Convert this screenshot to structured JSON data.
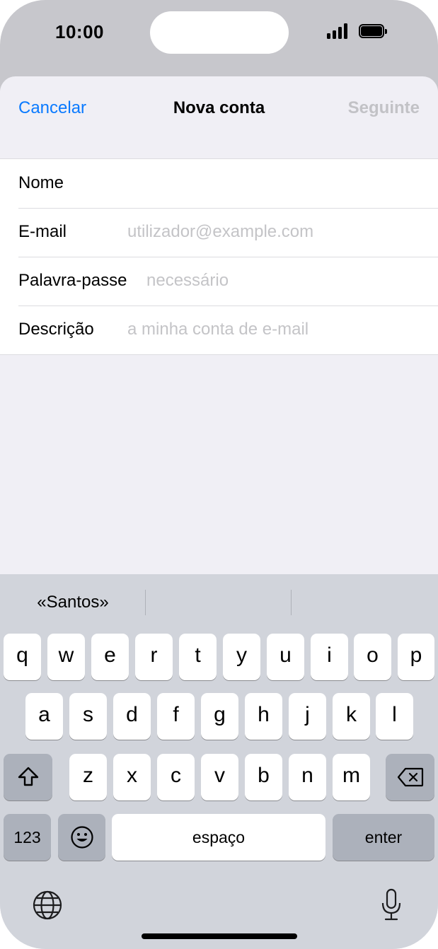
{
  "status_bar": {
    "time": "10:00"
  },
  "nav": {
    "cancel_label": "Cancelar",
    "title": "Nova conta",
    "next_label": "Seguinte"
  },
  "form": {
    "fields": [
      {
        "label": "Nome",
        "value": "",
        "placeholder": ""
      },
      {
        "label": "E-mail",
        "value": "",
        "placeholder": "utilizador@example.com"
      },
      {
        "label": "Palavra-passe",
        "value": "",
        "placeholder": "necessário"
      },
      {
        "label": "Descrição",
        "value": "",
        "placeholder": "a minha conta de e-mail"
      }
    ]
  },
  "keyboard": {
    "suggestions": [
      "«Santos»",
      "",
      ""
    ],
    "row1": [
      "q",
      "w",
      "e",
      "r",
      "t",
      "y",
      "u",
      "i",
      "o",
      "p"
    ],
    "row2": [
      "a",
      "s",
      "d",
      "f",
      "g",
      "h",
      "j",
      "k",
      "l"
    ],
    "row3": [
      "z",
      "x",
      "c",
      "v",
      "b",
      "n",
      "m"
    ],
    "numbers_label": "123",
    "space_label": "espaço",
    "enter_label": "enter",
    "icons": {
      "shift": "shift-icon",
      "delete": "backspace-icon",
      "emoji": "emoji-icon",
      "globe": "globe-icon",
      "mic": "microphone-icon"
    }
  },
  "colors": {
    "accent": "#0a7aff",
    "disabled": "#c2c2c6",
    "placeholder": "#c4c4c7",
    "sheet_bg": "#f0eff5",
    "keyboard_bg": "#d1d4db"
  }
}
